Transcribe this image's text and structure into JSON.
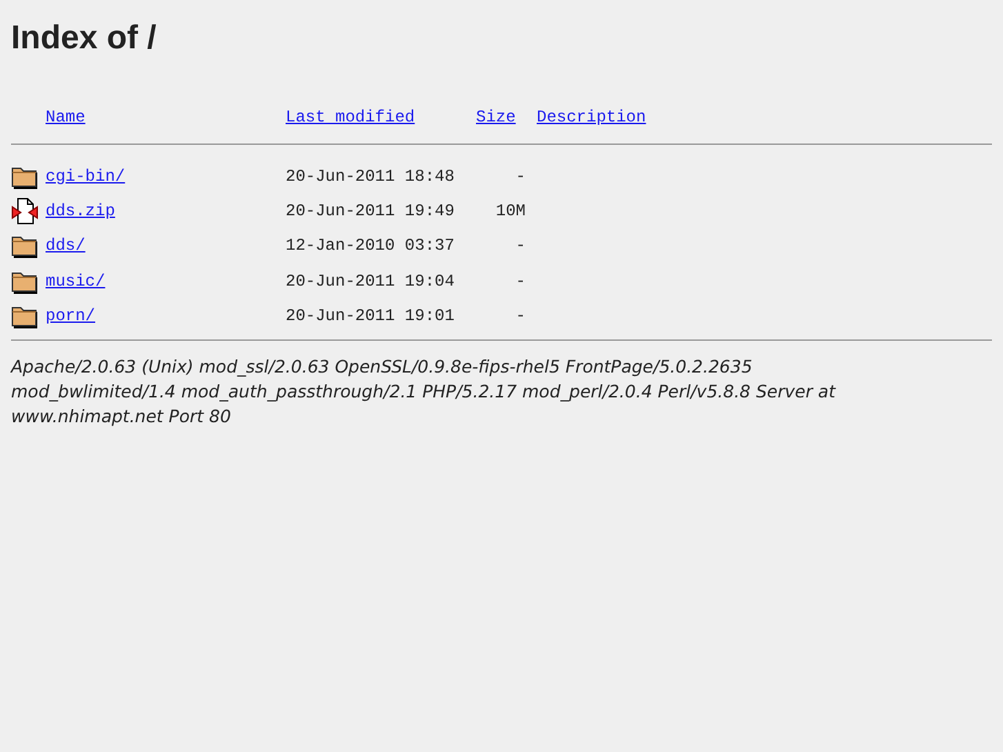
{
  "title": "Index of /",
  "columns": [
    "Name",
    "Last modified",
    "Size",
    "Description"
  ],
  "rows": [
    {
      "kind": "folder",
      "name": "cgi-bin/",
      "modified": "20-Jun-2011 18:48",
      "size": "-"
    },
    {
      "kind": "archive",
      "name": "dds.zip",
      "modified": "20-Jun-2011 19:49",
      "size": "10M"
    },
    {
      "kind": "folder",
      "name": "dds/",
      "modified": "12-Jan-2010 03:37",
      "size": "-"
    },
    {
      "kind": "folder",
      "name": "music/",
      "modified": "20-Jun-2011 19:04",
      "size": "-"
    },
    {
      "kind": "folder",
      "name": "porn/",
      "modified": "20-Jun-2011 19:01",
      "size": "-"
    }
  ],
  "address": "Apache/2.0.63 (Unix) mod_ssl/2.0.63 OpenSSL/0.9.8e-fips-rhel5 FrontPage/5.0.2.2635 mod_bwlimited/1.4 mod_auth_passthrough/2.1 PHP/5.2.17 mod_perl/2.0.4 Perl/v5.8.8 Server at www.nhimapt.net Port 80"
}
